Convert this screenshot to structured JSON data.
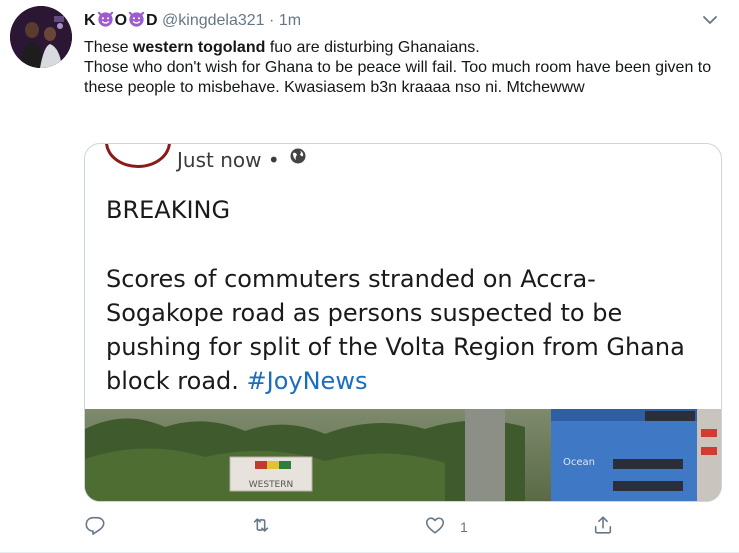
{
  "tweet": {
    "author_name_prefix": "K",
    "author_name_middle": "O",
    "author_name_suffix": "D",
    "handle": "@kingdela321",
    "separator": "·",
    "time": "1m",
    "body": {
      "line1_pre": "These ",
      "line1_bold": "western togoland",
      "line1_post": " fuo are disturbing Ghanaians.",
      "line2": "Those who don't wish for Ghana to be peace will fail. Too much room have been given to these people to misbehave. Kwasiasem b3n kraaaa nso ni. Mtchewww"
    },
    "actions": {
      "like_count": "1"
    }
  },
  "embedded": {
    "time": "Just now",
    "separator": "•",
    "breaking": "BREAKING",
    "body": "Scores of commuters stranded on Accra-Sogakope road as persons suspected to be pushing for split of the Volta Region from Ghana block road. ",
    "hashtag": "#JoyNews",
    "banner_text": "WESTERN",
    "sign_text": "Ocean"
  },
  "colors": {
    "accent": "#1b6dbf",
    "secondary_text": "#657786",
    "border": "#ccd6dd"
  },
  "icons": {
    "emoji": "smiling-devil-emoji",
    "chevron": "chevron-down-icon",
    "globe": "globe-icon",
    "reply": "reply-icon",
    "retweet": "retweet-icon",
    "like": "heart-icon",
    "share": "share-icon"
  }
}
